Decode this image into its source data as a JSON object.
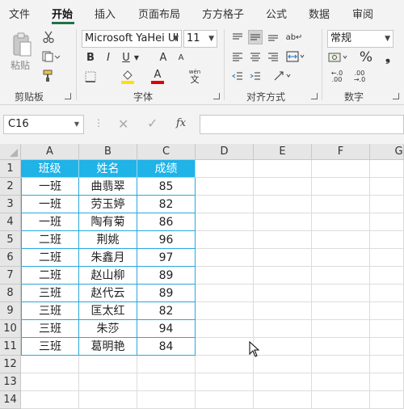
{
  "menu": {
    "tabs": [
      "文件",
      "开始",
      "插入",
      "页面布局",
      "方方格子",
      "公式",
      "数据",
      "审阅"
    ],
    "active": "开始"
  },
  "ribbon": {
    "clipboard": {
      "paste_label": "粘贴",
      "group_label": "剪贴板"
    },
    "font": {
      "family": "Microsoft YaHei UI",
      "size": "11",
      "group_label": "字体",
      "bold": "B",
      "italic": "I",
      "underline": "U",
      "grow": "A",
      "shrink": "A",
      "wen": "wén",
      "wen_char": "文"
    },
    "alignment": {
      "group_label": "对齐方式"
    },
    "number": {
      "format": "常规",
      "group_label": "数字",
      "percent": "%"
    }
  },
  "formula_bar": {
    "name_box": "C16",
    "fx": "fx",
    "content": ""
  },
  "sheet": {
    "columns": [
      "A",
      "B",
      "C",
      "D",
      "E",
      "F",
      "G"
    ],
    "rows": [
      "1",
      "2",
      "3",
      "4",
      "5",
      "6",
      "7",
      "8",
      "9",
      "10",
      "11",
      "12",
      "13",
      "14"
    ],
    "header": [
      "班级",
      "姓名",
      "成绩"
    ],
    "data": [
      [
        "一班",
        "曲翡翠",
        "85"
      ],
      [
        "一班",
        "劳玉婷",
        "82"
      ],
      [
        "一班",
        "陶有菊",
        "86"
      ],
      [
        "二班",
        "荆姚",
        "96"
      ],
      [
        "二班",
        "朱鑫月",
        "97"
      ],
      [
        "二班",
        "赵山柳",
        "89"
      ],
      [
        "三班",
        "赵代云",
        "89"
      ],
      [
        "三班",
        "匡太红",
        "82"
      ],
      [
        "三班",
        "朱莎",
        "94"
      ],
      [
        "三班",
        "葛明艳",
        "84"
      ]
    ]
  },
  "colors": {
    "accent": "#217346",
    "header_fill": "#1fb3e8",
    "table_border": "#2aa7dd"
  }
}
